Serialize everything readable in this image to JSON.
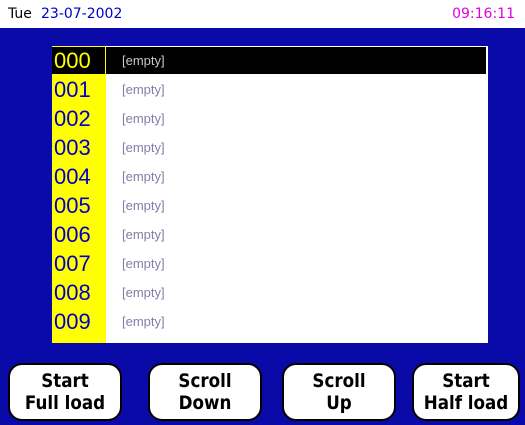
{
  "header": {
    "day": "Tue",
    "date": "23-07-2002",
    "time": "09:16:11"
  },
  "list": {
    "selected_index": 0,
    "rows": [
      {
        "num": "000",
        "text": "[empty]"
      },
      {
        "num": "001",
        "text": "[empty]"
      },
      {
        "num": "002",
        "text": "[empty]"
      },
      {
        "num": "003",
        "text": "[empty]"
      },
      {
        "num": "004",
        "text": "[empty]"
      },
      {
        "num": "005",
        "text": "[empty]"
      },
      {
        "num": "006",
        "text": "[empty]"
      },
      {
        "num": "007",
        "text": "[empty]"
      },
      {
        "num": "008",
        "text": "[empty]"
      },
      {
        "num": "009",
        "text": "[empty]"
      }
    ]
  },
  "buttons": {
    "start_full": {
      "line1": "Start",
      "line2": "Full load"
    },
    "scroll_down": {
      "line1": "Scroll",
      "line2": "Down"
    },
    "scroll_up": {
      "line1": "Scroll",
      "line2": "Up"
    },
    "start_half": {
      "line1": "Start",
      "line2": "Half load"
    }
  },
  "colors": {
    "screen_bg": "#0a0aa8",
    "number_column": "#ffff00",
    "date_text": "#0000c8",
    "time_text": "#e000e0"
  }
}
